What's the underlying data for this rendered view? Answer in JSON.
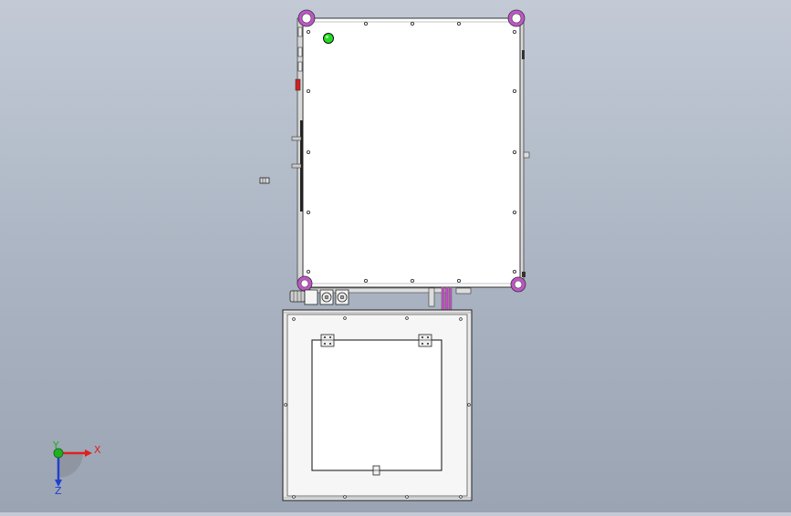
{
  "viewport": {
    "view": "cad-3d-top-view",
    "background_top": "#c3cad6",
    "background_bottom": "#9aa4b3"
  },
  "model": {
    "upper_cabinet": {
      "face_color": "#ffffff",
      "outline_color": "#3a3a3a"
    },
    "corner_feet_color": "#c055c8",
    "indicator_light_color": "#22dd22",
    "pipe_color": "#c050c8",
    "lower_frame": {
      "outer_color": "#e8e8e8",
      "inner_color": "#ffffff"
    }
  },
  "triad": {
    "x_label": "X",
    "y_label": "Y",
    "z_label": "Z",
    "x_color": "#e02020",
    "y_color": "#20b020",
    "z_color": "#2040d0"
  }
}
